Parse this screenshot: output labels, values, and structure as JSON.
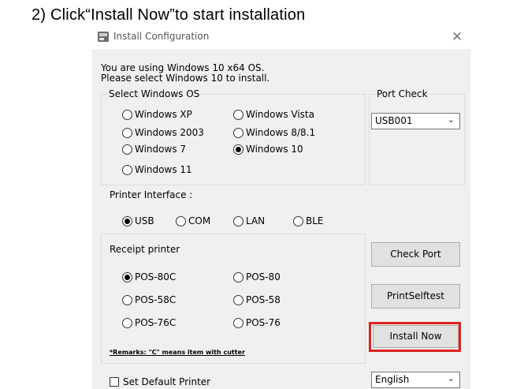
{
  "caption": "2) Click“Install Now”to start installation",
  "window": {
    "title": "Install Configuration",
    "close_glyph": "✕"
  },
  "info": {
    "line1": "You are using Windows 10 x64 OS.",
    "line2": "Please select Windows 10 to install."
  },
  "os_group": {
    "legend": "Select Windows OS",
    "options": [
      "Windows XP",
      "Windows Vista",
      "Windows 2003",
      "Windows 8/8.1",
      "Windows 7",
      "Windows 10",
      "Windows 11"
    ],
    "selected": "Windows 10"
  },
  "port_check": {
    "legend": "Port Check",
    "selected": "USB001"
  },
  "interface": {
    "label": "Printer Interface :",
    "options": [
      "USB",
      "COM",
      "LAN",
      "BLE"
    ],
    "selected": "USB"
  },
  "receipt": {
    "legend": "Receipt printer",
    "options": [
      "POS-80C",
      "POS-80",
      "POS-58C",
      "POS-58",
      "POS-76C",
      "POS-76"
    ],
    "selected": "POS-80C",
    "remark": "*Remarks: \"C\" means item with cutter"
  },
  "buttons": {
    "check_port": "Check Port",
    "print_selftest": "PrintSelftest",
    "install_now": "Install Now"
  },
  "default_printer": {
    "label": "Set Default Printer",
    "checked": false
  },
  "language": {
    "selected": "English"
  },
  "colors": {
    "highlight": "#e02020",
    "window_bg": "#f0f0f0"
  },
  "icons": {
    "dropdown": "chevron-down-icon",
    "close": "close-icon"
  }
}
